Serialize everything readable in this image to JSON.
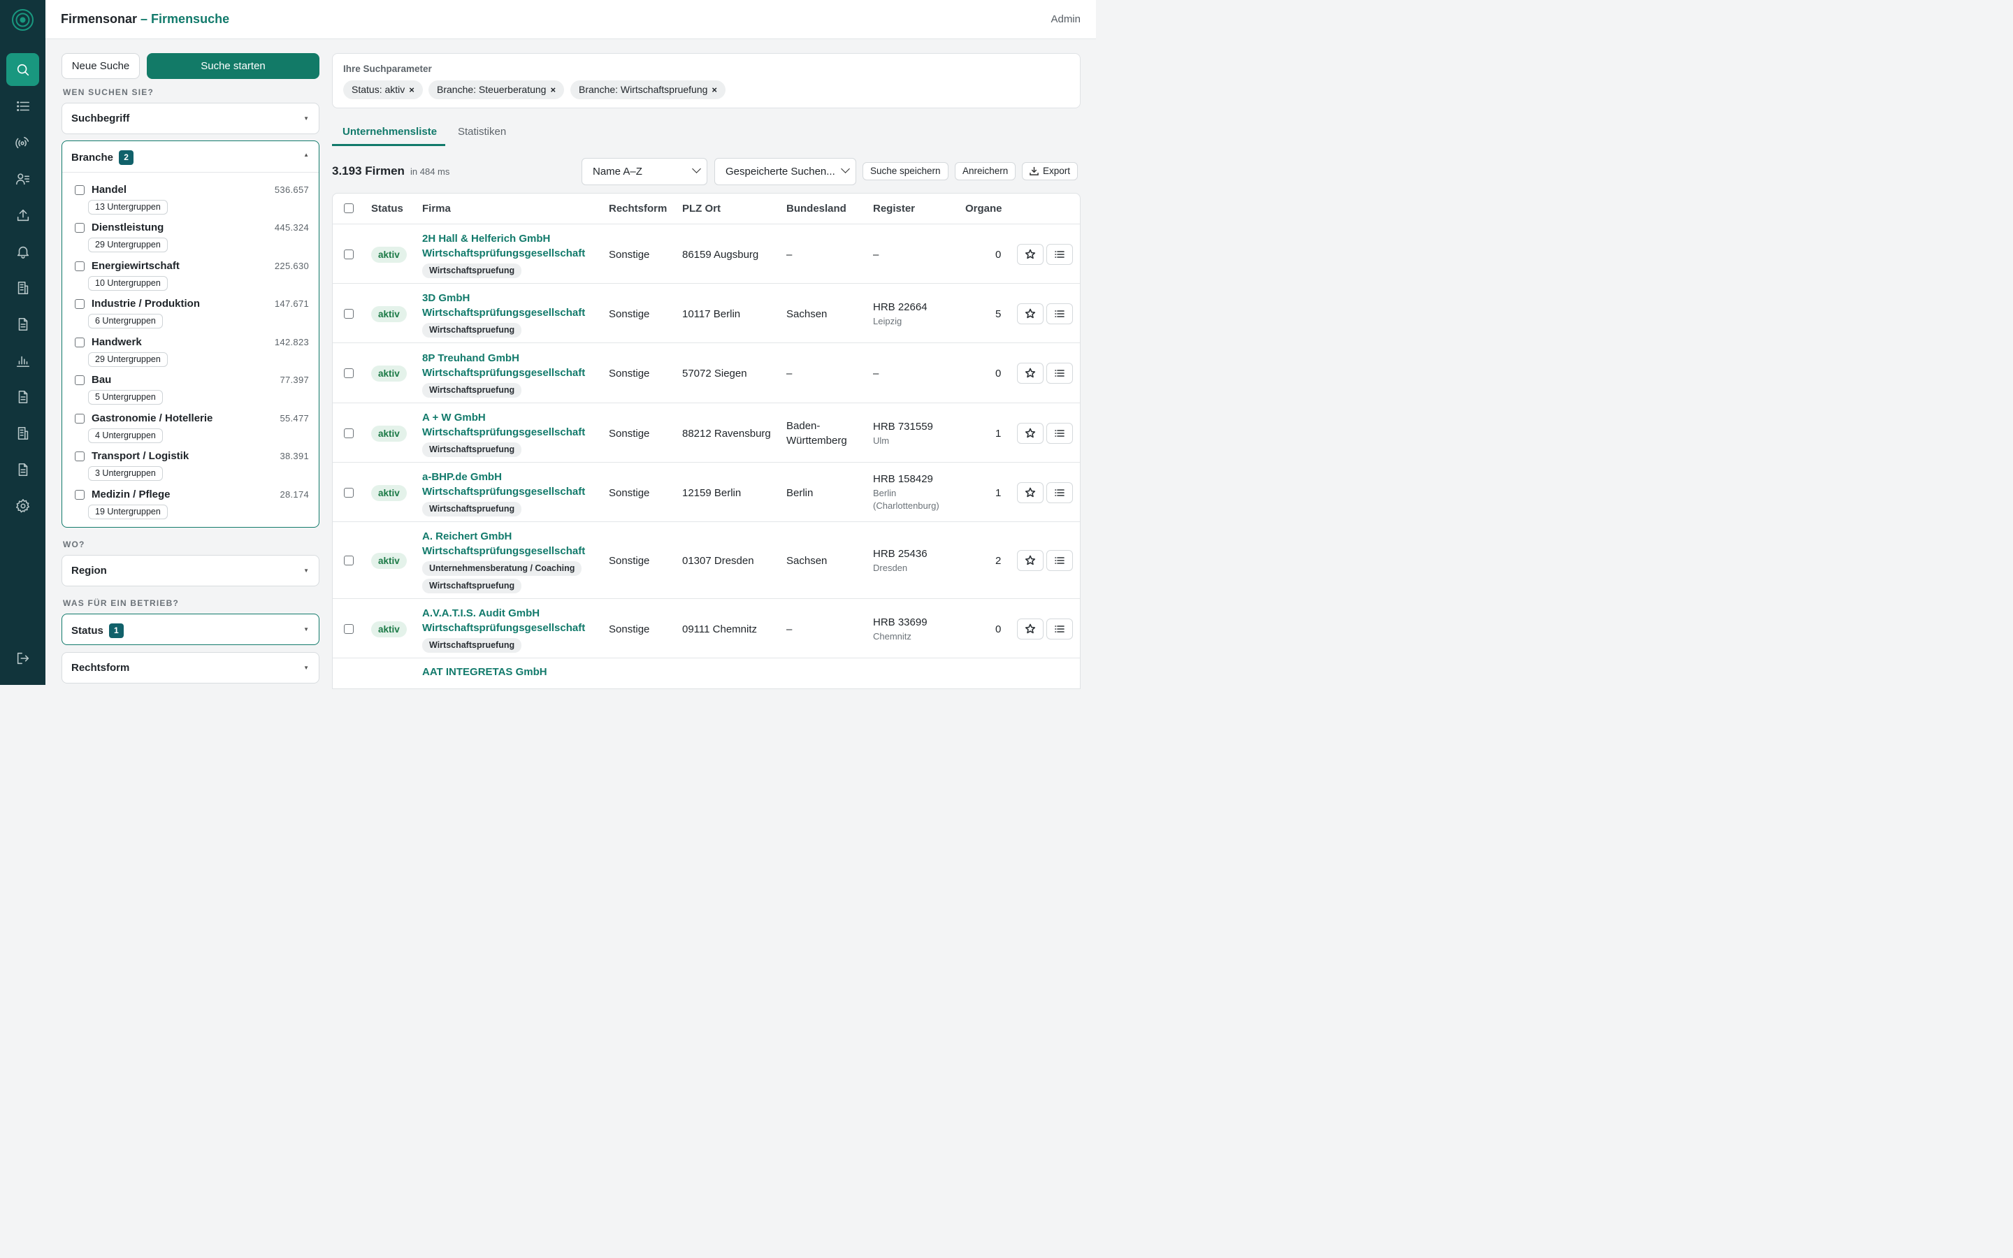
{
  "app": {
    "name": "Firmensonar",
    "separator": " – ",
    "page": "Firmensuche",
    "user": "Admin"
  },
  "actions": {
    "new_search": "Neue Suche",
    "start_search": "Suche starten"
  },
  "sections": {
    "who": "WEN SUCHEN SIE?",
    "where": "WO?",
    "what": "WAS FÜR EIN BETRIEB?"
  },
  "filters": {
    "suchbegriff": "Suchbegriff",
    "branche": {
      "label": "Branche",
      "badge": "2"
    },
    "region": "Region",
    "status": {
      "label": "Status",
      "badge": "1"
    },
    "rechtsform": "Rechtsform"
  },
  "branchen": [
    {
      "name": "Handel",
      "count": "536.657",
      "sub": "13 Untergruppen"
    },
    {
      "name": "Dienstleistung",
      "count": "445.324",
      "sub": "29 Untergruppen"
    },
    {
      "name": "Energiewirtschaft",
      "count": "225.630",
      "sub": "10 Untergruppen"
    },
    {
      "name": "Industrie / Produktion",
      "count": "147.671",
      "sub": "6 Untergruppen"
    },
    {
      "name": "Handwerk",
      "count": "142.823",
      "sub": "29 Untergruppen"
    },
    {
      "name": "Bau",
      "count": "77.397",
      "sub": "5 Untergruppen"
    },
    {
      "name": "Gastronomie / Hotellerie",
      "count": "55.477",
      "sub": "4 Untergruppen"
    },
    {
      "name": "Transport / Logistik",
      "count": "38.391",
      "sub": "3 Untergruppen"
    },
    {
      "name": "Medizin / Pflege",
      "count": "28.174",
      "sub": "19 Untergruppen"
    }
  ],
  "params": {
    "title": "Ihre Suchparameter",
    "chips": [
      "Status: aktiv",
      "Branche: Steuerberatung",
      "Branche: Wirtschaftspruefung"
    ],
    "remove": "×"
  },
  "tabs": {
    "list": "Unternehmensliste",
    "stats": "Statistiken"
  },
  "results": {
    "count": "3.193 Firmen",
    "time": "in 484 ms"
  },
  "toolbar": {
    "sort": "Name A–Z",
    "saved": "Gespeicherte Suchen...",
    "save": "Suche speichern",
    "enrich": "Anreichern",
    "export": "Export"
  },
  "table": {
    "headers": {
      "status": "Status",
      "firma": "Firma",
      "rechtsform": "Rechtsform",
      "plz": "PLZ Ort",
      "land": "Bundesland",
      "register": "Register",
      "organe": "Organe"
    },
    "rows": [
      {
        "status": "aktiv",
        "name1": "2H Hall & Helferich GmbH",
        "name2": "Wirtschaftsprüfungsgesellschaft",
        "tags": [
          "Wirtschaftspruefung"
        ],
        "rechtsform": "Sonstige",
        "ort": "86159 Augsburg",
        "land1": "–",
        "land2": "",
        "reg1": "–",
        "reg2": "",
        "reg3": "",
        "organe": "0"
      },
      {
        "status": "aktiv",
        "name1": "3D GmbH",
        "name2": "Wirtschaftsprüfungsgesellschaft",
        "tags": [
          "Wirtschaftspruefung"
        ],
        "rechtsform": "Sonstige",
        "ort": "10117 Berlin",
        "land1": "Sachsen",
        "land2": "",
        "reg1": "HRB 22664",
        "reg2": "Leipzig",
        "reg3": "",
        "organe": "5"
      },
      {
        "status": "aktiv",
        "name1": "8P Treuhand GmbH",
        "name2": "Wirtschaftsprüfungsgesellschaft",
        "tags": [
          "Wirtschaftspruefung"
        ],
        "rechtsform": "Sonstige",
        "ort": "57072 Siegen",
        "land1": "–",
        "land2": "",
        "reg1": "–",
        "reg2": "",
        "reg3": "",
        "organe": "0"
      },
      {
        "status": "aktiv",
        "name1": "A + W GmbH",
        "name2": "Wirtschaftsprüfungsgesellschaft",
        "tags": [
          "Wirtschaftspruefung"
        ],
        "rechtsform": "Sonstige",
        "ort": "88212 Ravensburg",
        "land1": "Baden-",
        "land2": "Württemberg",
        "reg1": "HRB 731559",
        "reg2": "Ulm",
        "reg3": "",
        "organe": "1"
      },
      {
        "status": "aktiv",
        "name1": "a-BHP.de GmbH",
        "name2": "Wirtschaftsprüfungsgesellschaft",
        "tags": [
          "Wirtschaftspruefung"
        ],
        "rechtsform": "Sonstige",
        "ort": "12159 Berlin",
        "land1": "Berlin",
        "land2": "",
        "reg1": "HRB 158429",
        "reg2": "Berlin",
        "reg3": "(Charlottenburg)",
        "organe": "1"
      },
      {
        "status": "aktiv",
        "name1": "A. Reichert GmbH",
        "name2": "Wirtschaftsprüfungsgesellschaft",
        "tags": [
          "Unternehmensberatung / Coaching",
          "Wirtschaftspruefung"
        ],
        "rechtsform": "Sonstige",
        "ort": "01307 Dresden",
        "land1": "Sachsen",
        "land2": "",
        "reg1": "HRB 25436",
        "reg2": "Dresden",
        "reg3": "",
        "organe": "2"
      },
      {
        "status": "aktiv",
        "name1": "A.V.A.T.I.S. Audit GmbH",
        "name2": "Wirtschaftsprüfungsgesellschaft",
        "tags": [
          "Wirtschaftspruefung"
        ],
        "rechtsform": "Sonstige",
        "ort": "09111 Chemnitz",
        "land1": "–",
        "land2": "",
        "reg1": "HRB 33699",
        "reg2": "Chemnitz",
        "reg3": "",
        "organe": "0"
      },
      {
        "status": "",
        "name1": "AAT INTEGRETAS GmbH",
        "name2": "",
        "tags": [],
        "rechtsform": "",
        "ort": "",
        "land1": "",
        "land2": "",
        "reg1": "",
        "reg2": "",
        "reg3": "",
        "organe": ""
      }
    ]
  }
}
